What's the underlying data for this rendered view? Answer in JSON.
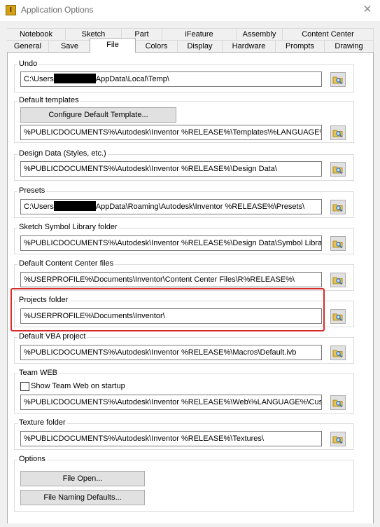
{
  "window": {
    "title": "Application Options",
    "close_glyph": "✕"
  },
  "tabs_row1": [
    "Notebook",
    "Sketch",
    "Part",
    "iFeature",
    "Assembly",
    "Content Center"
  ],
  "tabs_row2": [
    "General",
    "Save",
    "File",
    "Colors",
    "Display",
    "Hardware",
    "Prompts",
    "Drawing"
  ],
  "active_tab": "File",
  "groups": {
    "undo": {
      "label": "Undo",
      "value_prefix": "C:\\Users",
      "value_suffix": "AppData\\Local\\Temp\\"
    },
    "default_templates": {
      "label": "Default templates",
      "button": "Configure Default Template...",
      "value": "%PUBLICDOCUMENTS%\\Autodesk\\Inventor %RELEASE%\\Templates\\%LANGUAGE%\\"
    },
    "design_data": {
      "label": "Design Data (Styles, etc.)",
      "value": "%PUBLICDOCUMENTS%\\Autodesk\\Inventor %RELEASE%\\Design Data\\"
    },
    "presets": {
      "label": "Presets",
      "value_prefix": "C:\\Users",
      "value_suffix": "AppData\\Roaming\\Autodesk\\Inventor %RELEASE%\\Presets\\"
    },
    "sketch_symbol": {
      "label": "Sketch Symbol Library folder",
      "value": "%PUBLICDOCUMENTS%\\Autodesk\\Inventor %RELEASE%\\Design Data\\Symbol Library\\"
    },
    "content_center": {
      "label": "Default Content Center files",
      "value": "%USERPROFILE%\\Documents\\Inventor\\Content Center Files\\R%RELEASE%\\"
    },
    "projects": {
      "label": "Projects folder",
      "value": "%USERPROFILE%\\Documents\\Inventor\\"
    },
    "vba": {
      "label": "Default VBA project",
      "value": "%PUBLICDOCUMENTS%\\Autodesk\\Inventor %RELEASE%\\Macros\\Default.ivb"
    },
    "team_web": {
      "label": "Team WEB",
      "checkbox_label": "Show Team Web on startup",
      "checked": false,
      "value": "%PUBLICDOCUMENTS%\\Autodesk\\Inventor %RELEASE%\\Web\\%LANGUAGE%\\Custom"
    },
    "texture": {
      "label": "Texture folder",
      "value": "%PUBLICDOCUMENTS%\\Autodesk\\Inventor %RELEASE%\\Textures\\"
    },
    "options": {
      "label": "Options",
      "file_open": "File Open...",
      "file_naming": "File Naming Defaults..."
    }
  },
  "colors": {
    "highlight": "#d62b2b",
    "folder_icon": "#e8c24a",
    "magnifier": "#2a6fc9"
  },
  "icons": {
    "browse": "folder-magnifier-icon",
    "app": "inventor-app-icon"
  }
}
